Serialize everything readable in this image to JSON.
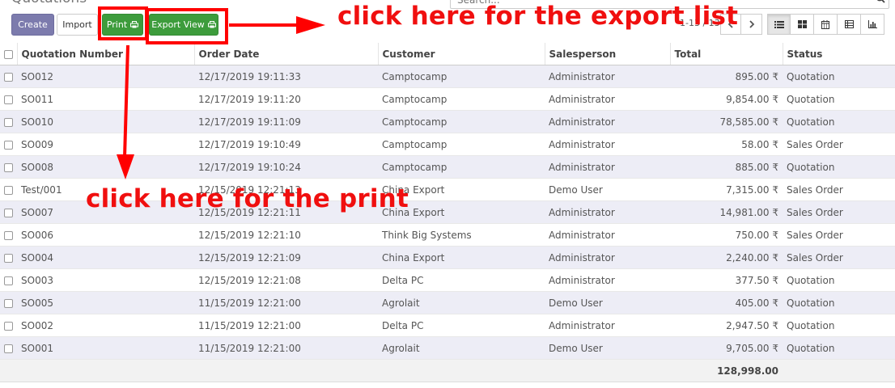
{
  "header": {
    "title": "Quotations",
    "search_placeholder": "Search..."
  },
  "toolbar": {
    "create_label": "Create",
    "import_label": "Import",
    "print_label": "Print",
    "export_label": "Export View"
  },
  "pager": {
    "text": "1-13 / 13"
  },
  "table": {
    "columns": [
      "Quotation Number",
      "Order Date",
      "Customer",
      "Salesperson",
      "Total",
      "Status"
    ],
    "rows": [
      [
        "SO012",
        "12/17/2019 19:11:33",
        "Camptocamp",
        "Administrator",
        "895.00 ₹",
        "Quotation"
      ],
      [
        "SO011",
        "12/17/2019 19:11:20",
        "Camptocamp",
        "Administrator",
        "9,854.00 ₹",
        "Quotation"
      ],
      [
        "SO010",
        "12/17/2019 19:11:09",
        "Camptocamp",
        "Administrator",
        "78,585.00 ₹",
        "Quotation"
      ],
      [
        "SO009",
        "12/17/2019 19:10:49",
        "Camptocamp",
        "Administrator",
        "58.00 ₹",
        "Sales Order"
      ],
      [
        "SO008",
        "12/17/2019 19:10:24",
        "Camptocamp",
        "Administrator",
        "885.00 ₹",
        "Quotation"
      ],
      [
        "Test/001",
        "12/15/2019 12:21:13",
        "China Export",
        "Demo User",
        "7,315.00 ₹",
        "Sales Order"
      ],
      [
        "SO007",
        "12/15/2019 12:21:11",
        "China Export",
        "Administrator",
        "14,981.00 ₹",
        "Sales Order"
      ],
      [
        "SO006",
        "12/15/2019 12:21:10",
        "Think Big Systems",
        "Administrator",
        "750.00 ₹",
        "Sales Order"
      ],
      [
        "SO004",
        "12/15/2019 12:21:09",
        "China Export",
        "Administrator",
        "2,240.00 ₹",
        "Sales Order"
      ],
      [
        "SO003",
        "12/15/2019 12:21:08",
        "Delta PC",
        "Administrator",
        "377.50 ₹",
        "Quotation"
      ],
      [
        "SO005",
        "11/15/2019 12:21:00",
        "Agrolait",
        "Demo User",
        "405.00 ₹",
        "Quotation"
      ],
      [
        "SO002",
        "11/15/2019 12:21:00",
        "Delta PC",
        "Administrator",
        "2,947.50 ₹",
        "Quotation"
      ],
      [
        "SO001",
        "11/15/2019 12:21:00",
        "Agrolait",
        "Demo User",
        "9,705.00 ₹",
        "Quotation"
      ]
    ],
    "total": "128,998.00"
  },
  "annotations": {
    "export": "click here for the export list",
    "print": "click here for the print",
    "color": "#ff0000"
  },
  "colors": {
    "create_button": "#7c7bad",
    "print_button": "#3d9c3c",
    "row_odd": "#ededf6"
  },
  "icons": [
    "printer-icon",
    "search-icon",
    "chevron-left-icon",
    "chevron-right-icon",
    "list-view-icon",
    "kanban-view-icon",
    "calendar-view-icon",
    "pivot-view-icon",
    "graph-view-icon"
  ]
}
